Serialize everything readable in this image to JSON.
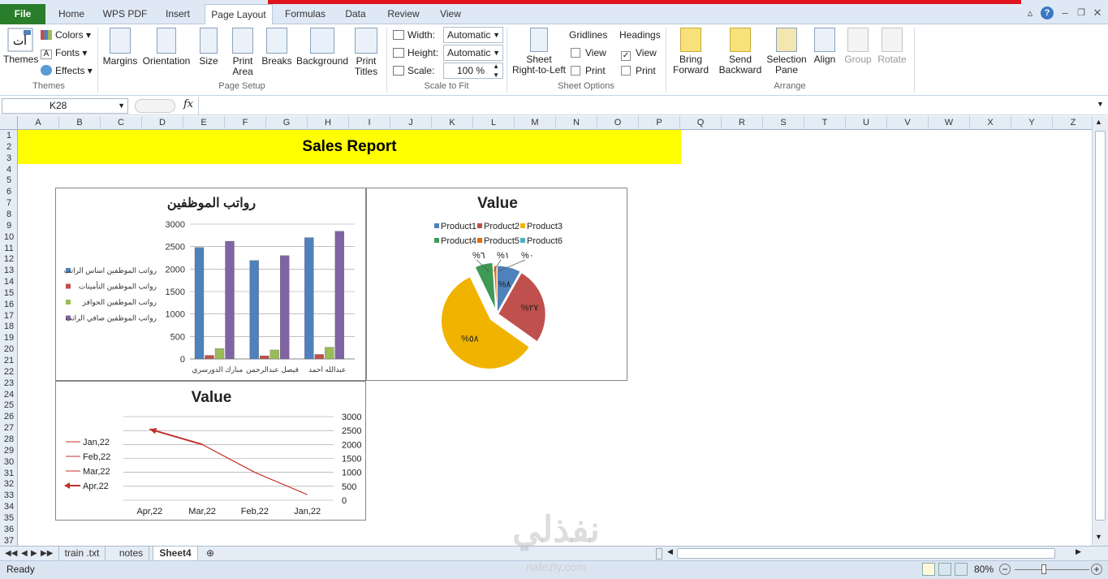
{
  "tabs": {
    "file": "File",
    "items": [
      "Home",
      "WPS PDF",
      "Insert",
      "Page Layout",
      "Formulas",
      "Data",
      "Review",
      "View"
    ]
  },
  "ribbon": {
    "themes": {
      "label": "Themes",
      "colors": "Colors",
      "fonts": "Fonts",
      "effects": "Effects",
      "group": "Themes"
    },
    "page_setup": {
      "margins": "Margins",
      "orientation": "Orientation",
      "size": "Size",
      "print_area": [
        "Print",
        "Area"
      ],
      "breaks": "Breaks",
      "background": "Background",
      "print_titles": [
        "Print",
        "Titles"
      ],
      "group": "Page Setup"
    },
    "scale": {
      "width_label": "Width:",
      "width_value": "Automatic",
      "height_label": "Height:",
      "height_value": "Automatic",
      "scale_label": "Scale:",
      "scale_value": "100 %",
      "group": "Scale to Fit"
    },
    "sheet_options": {
      "sheet_rtl": [
        "Sheet",
        "Right-to-Left"
      ],
      "gridlines": "Gridlines",
      "headings": "Headings",
      "view": "View",
      "print": "Print",
      "group": "Sheet Options",
      "headings_view_checked": true
    },
    "arrange": {
      "bring_forward": [
        "Bring",
        "Forward"
      ],
      "send_backward": [
        "Send",
        "Backward"
      ],
      "selection_pane": [
        "Selection",
        "Pane"
      ],
      "align": "Align",
      "group_btn": "Group",
      "rotate": "Rotate",
      "group": "Arrange"
    }
  },
  "formula_bar": {
    "name_box": "K28",
    "fx": "fx",
    "value": ""
  },
  "columns": [
    "A",
    "B",
    "C",
    "D",
    "E",
    "F",
    "G",
    "H",
    "I",
    "J",
    "K",
    "L",
    "M",
    "N",
    "O",
    "P",
    "Q",
    "R",
    "S",
    "T",
    "U",
    "V",
    "W",
    "X",
    "Y",
    "Z"
  ],
  "rows": [
    "1",
    "2",
    "3",
    "4",
    "5",
    "6",
    "7",
    "8",
    "9",
    "10",
    "11",
    "12",
    "13",
    "14",
    "15",
    "16",
    "17",
    "18",
    "19",
    "20",
    "21",
    "22",
    "23",
    "24",
    "25",
    "26",
    "27",
    "28",
    "29",
    "30",
    "31",
    "32",
    "33",
    "34",
    "35",
    "36",
    "37"
  ],
  "banner": {
    "title": "Sales Report",
    "color": "#ffff00"
  },
  "chart_data": [
    {
      "type": "bar",
      "title": "رواتب الموظفين",
      "categories": [
        "مبارك الدورسري",
        "فيصل عبدالرحمن",
        "عبدالله احمد"
      ],
      "series": [
        {
          "name": "رواتب الموظفين اساس الراتب",
          "color": "#4f81bd",
          "values": [
            2480,
            2190,
            2700
          ]
        },
        {
          "name": "رواتب الموظفين التأمينات",
          "color": "#c0504d",
          "values": [
            80,
            70,
            100
          ]
        },
        {
          "name": "رواتب الموظفين الحوافز",
          "color": "#9bbb59",
          "values": [
            230,
            200,
            260
          ]
        },
        {
          "name": "رواتب الموظفين صافي الراتب",
          "color": "#8064a2",
          "values": [
            2620,
            2300,
            2840
          ]
        }
      ],
      "yticks": [
        "3000",
        "2500",
        "2000",
        "1500",
        "1000",
        "500",
        "0"
      ],
      "ylim": [
        0,
        3000
      ],
      "grid": true,
      "legend": "left"
    },
    {
      "type": "pie",
      "title": "Value",
      "legend": [
        "Product1",
        "Product2",
        "Product3",
        "Product4",
        "Product5",
        "Product6"
      ],
      "legend_colors": [
        "#4f81bd",
        "#c0504d",
        "#f0b400",
        "#3e9a55",
        "#e36c0a",
        "#4bacc6"
      ],
      "values": [
        8,
        27,
        58,
        6,
        1,
        0
      ],
      "labels": [
        "%٨",
        "%٢٧",
        "%٥٨",
        "%٦",
        "%١",
        "%٠"
      ]
    },
    {
      "type": "line",
      "title": "Value",
      "categories": [
        "Apr,22",
        "Mar,22",
        "Feb,22",
        "Jan,22"
      ],
      "legend": [
        "Jan,22",
        "Feb,22",
        "Mar,22",
        "Apr,22"
      ],
      "values": [
        2550,
        2000,
        1000,
        200
      ],
      "yticks": [
        "3000",
        "2500",
        "2000",
        "1500",
        "1000",
        "500",
        "0"
      ],
      "ylim": [
        0,
        3000
      ],
      "line_color": "#c0302a",
      "axis_position": "right"
    }
  ],
  "sheet_tabs": [
    "train .txt",
    "notes",
    "Sheet4"
  ],
  "status": {
    "ready": "Ready",
    "zoom": "80%"
  },
  "watermark": {
    "text": "نفذلي",
    "sub": "nafezly.com"
  }
}
